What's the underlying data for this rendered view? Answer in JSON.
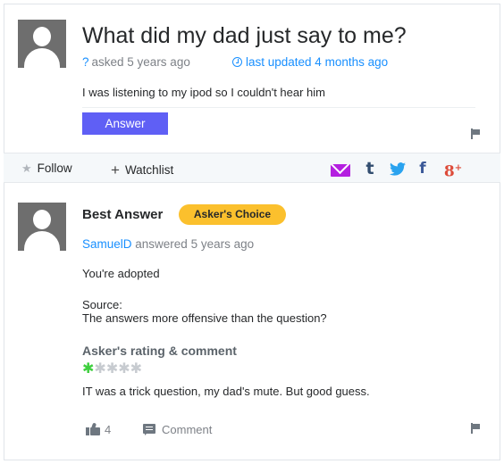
{
  "question": {
    "title": "What did my dad just say to me?",
    "icon_mark": "?",
    "asked": "asked 5 years ago",
    "updated": "last updated 4 months ago",
    "body": "I was listening to my ipod so I couldn't hear him",
    "answer_button": "Answer"
  },
  "toolbar": {
    "follow": "Follow",
    "watchlist": "Watchlist",
    "share": {
      "tumblr": "t",
      "facebook": "f",
      "googleplus": "8",
      "googleplus_sup": "+"
    }
  },
  "best_answer": {
    "heading": "Best Answer",
    "badge": "Asker's Choice",
    "user": "SamuelD",
    "answered": " answered 5 years ago",
    "text": "You're adopted",
    "source_label": "Source:",
    "source_text": "The answers more offensive than the question?",
    "rating_label": "Asker's rating & comment",
    "rating": {
      "stars": 1,
      "max": 5
    },
    "rating_comment": "IT was a trick question, my dad's mute. But good guess.",
    "likes": "4",
    "comment": "Comment"
  },
  "colors": {
    "link": "#188fff",
    "answer_button": "#5f5ff5",
    "badge": "#fbc02d",
    "star_on": "#3fcf3f",
    "mail": "#b41fe0"
  },
  "icons": [
    "avatar-icon",
    "clock-icon",
    "flag-icon",
    "star-icon",
    "plus-icon",
    "mail-icon",
    "tumblr-icon",
    "twitter-icon",
    "facebook-icon",
    "googleplus-icon",
    "thumbs-up-icon",
    "comment-icon"
  ]
}
